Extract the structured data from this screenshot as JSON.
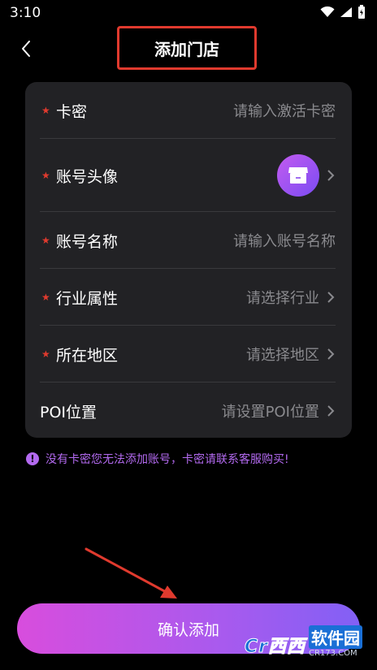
{
  "status_bar": {
    "time": "3:10"
  },
  "nav": {
    "title": "添加门店"
  },
  "form": {
    "rows": [
      {
        "label": "卡密",
        "required": true,
        "value": "请输入激活卡密",
        "chevron": false
      },
      {
        "label": "账号头像",
        "required": true,
        "value": "",
        "chevron": true
      },
      {
        "label": "账号名称",
        "required": true,
        "value": "请输入账号名称",
        "chevron": false
      },
      {
        "label": "行业属性",
        "required": true,
        "value": "请选择行业",
        "chevron": true
      },
      {
        "label": "所在地区",
        "required": true,
        "value": "请选择地区",
        "chevron": true
      },
      {
        "label": "POI位置",
        "required": false,
        "value": "请设置POI位置",
        "chevron": true
      }
    ]
  },
  "notice": {
    "icon": "!",
    "text": "没有卡密您无法添加账号，卡密请联系客服购买!"
  },
  "confirm_button": {
    "label": "确认添加"
  },
  "watermark": {
    "logo": "Cr西西",
    "main": "软件园",
    "sub": "CR173.COM"
  },
  "colors": {
    "accent_purple": "#b36af0",
    "required_red": "#e03a2e",
    "card_bg": "#222225",
    "highlight_red": "#e03a2e"
  }
}
